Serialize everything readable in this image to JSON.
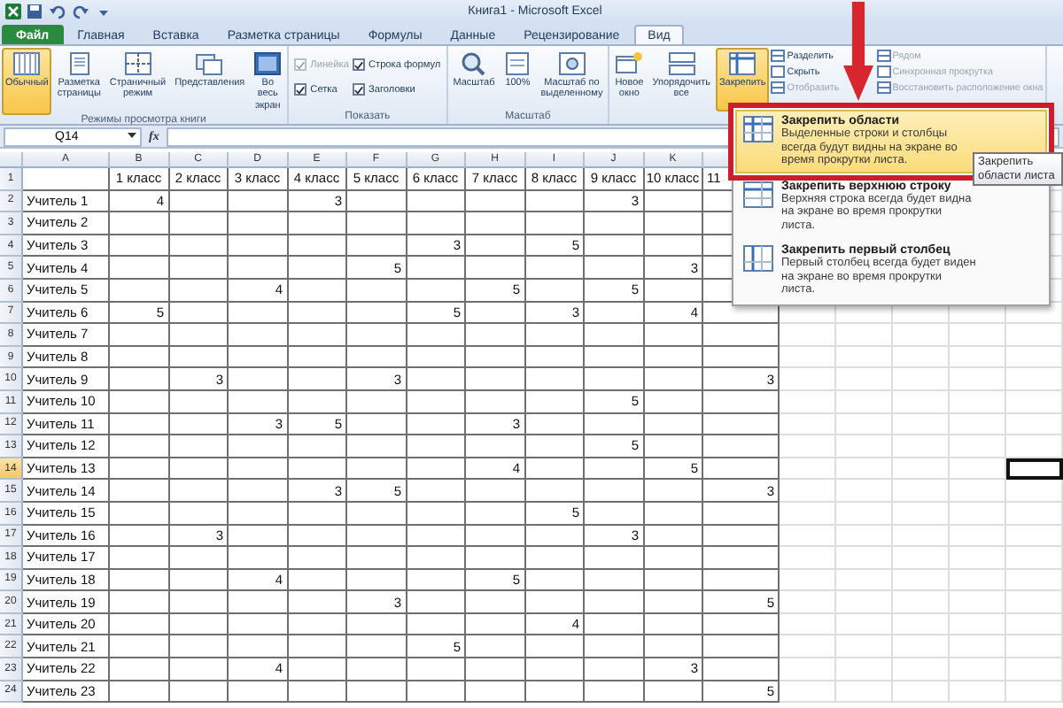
{
  "title_bar": {
    "title": "Книга1 - Microsoft Excel"
  },
  "ribbon_tabs": [
    {
      "label": "Файл",
      "kind": "file",
      "selected": false
    },
    {
      "label": "Главная",
      "kind": "tab",
      "selected": false
    },
    {
      "label": "Вставка",
      "kind": "tab",
      "selected": false
    },
    {
      "label": "Разметка страницы",
      "kind": "tab",
      "selected": false
    },
    {
      "label": "Формулы",
      "kind": "tab",
      "selected": false
    },
    {
      "label": "Данные",
      "kind": "tab",
      "selected": false
    },
    {
      "label": "Рецензирование",
      "kind": "tab",
      "selected": false
    },
    {
      "label": "Вид",
      "kind": "tab",
      "selected": true
    }
  ],
  "ribbon_groups": [
    {
      "label": "Режимы просмотра книги",
      "items": [
        {
          "kind": "large",
          "label": "Обычный",
          "selected": true
        },
        {
          "kind": "large",
          "label": "Разметка страницы",
          "selected": false
        },
        {
          "kind": "large",
          "label": "Страничный режим",
          "selected": false
        },
        {
          "kind": "large",
          "label": "Представления",
          "selected": false
        },
        {
          "kind": "large",
          "label": "Во весь экран",
          "selected": false
        }
      ]
    },
    {
      "label": "Показать",
      "items": [
        {
          "kind": "check",
          "label": "Линейка",
          "checked": true,
          "disabled": true
        },
        {
          "kind": "check",
          "label": "Сетка",
          "checked": true,
          "disabled": false
        },
        {
          "kind": "check",
          "label": "Строка формул",
          "checked": true,
          "disabled": false
        },
        {
          "kind": "check",
          "label": "Заголовки",
          "checked": true,
          "disabled": false
        }
      ]
    },
    {
      "label": "Масштаб",
      "items": [
        {
          "kind": "large",
          "label": "Масштаб",
          "selected": false
        },
        {
          "kind": "large",
          "label": "100%",
          "selected": false
        },
        {
          "kind": "large",
          "label": "Масштаб по выделенному",
          "selected": false
        }
      ]
    },
    {
      "items": [
        {
          "kind": "large",
          "label": "Новое окно",
          "selected": false
        },
        {
          "kind": "large",
          "label": "Упорядочить все",
          "selected": false
        },
        {
          "kind": "large",
          "label": "Закрепить",
          "selected": true
        },
        {
          "kind": "small",
          "label": "Разделить",
          "disabled": false
        },
        {
          "kind": "small",
          "label": "Скрыть",
          "disabled": false
        },
        {
          "kind": "small",
          "label": "Отобразить",
          "disabled": true
        },
        {
          "kind": "small",
          "label": "Рядом",
          "disabled": true
        },
        {
          "kind": "small",
          "label": "Синхронная прокрутка",
          "disabled": true
        },
        {
          "kind": "small",
          "label": "Восстановить расположение окна",
          "disabled": true
        }
      ]
    }
  ],
  "formula_bar": {
    "name_box": "Q14",
    "fx": "fx"
  },
  "sheet": {
    "column_letters": [
      "A",
      "B",
      "C",
      "D",
      "E",
      "F",
      "G",
      "H",
      "I",
      "J",
      "K"
    ],
    "header_row": {
      "number": "1",
      "labels": [
        "1 класс",
        "2 класс",
        "3 класс",
        "4 класс",
        "5 класс",
        "6 класс",
        "7 класс",
        "8 класс",
        "9 класс",
        "10 класс",
        "11"
      ]
    },
    "rows": [
      {
        "number": "2",
        "selected": false,
        "teacher": "Учитель 1",
        "cells": [
          "4",
          null,
          null,
          "3",
          null,
          null,
          null,
          null,
          "3",
          null,
          null
        ]
      },
      {
        "number": "3",
        "selected": false,
        "teacher": "Учитель 2",
        "cells": [
          null,
          null,
          null,
          null,
          null,
          null,
          null,
          null,
          null,
          null,
          null
        ]
      },
      {
        "number": "4",
        "selected": false,
        "teacher": "Учитель 3",
        "cells": [
          null,
          null,
          null,
          null,
          null,
          "3",
          null,
          "5",
          null,
          null,
          null
        ]
      },
      {
        "number": "5",
        "selected": false,
        "teacher": "Учитель 4",
        "cells": [
          null,
          null,
          null,
          null,
          "5",
          null,
          null,
          null,
          null,
          "3",
          null
        ]
      },
      {
        "number": "6",
        "selected": false,
        "teacher": "Учитель 5",
        "cells": [
          null,
          null,
          "4",
          null,
          null,
          null,
          "5",
          null,
          "5",
          null,
          null
        ]
      },
      {
        "number": "7",
        "selected": false,
        "teacher": "Учитель 6",
        "cells": [
          "5",
          null,
          null,
          null,
          null,
          "5",
          null,
          "3",
          null,
          "4",
          null
        ]
      },
      {
        "number": "8",
        "selected": false,
        "teacher": "Учитель 7",
        "cells": [
          null,
          null,
          null,
          null,
          null,
          null,
          null,
          null,
          null,
          null,
          null
        ]
      },
      {
        "number": "9",
        "selected": false,
        "teacher": "Учитель 8",
        "cells": [
          null,
          null,
          null,
          null,
          null,
          null,
          null,
          null,
          null,
          null,
          null
        ]
      },
      {
        "number": "10",
        "selected": false,
        "teacher": "Учитель 9",
        "cells": [
          null,
          "3",
          null,
          null,
          "3",
          null,
          null,
          null,
          null,
          null,
          "3"
        ]
      },
      {
        "number": "11",
        "selected": false,
        "teacher": "Учитель 10",
        "cells": [
          null,
          null,
          null,
          null,
          null,
          null,
          null,
          null,
          "5",
          null,
          null
        ]
      },
      {
        "number": "12",
        "selected": false,
        "teacher": "Учитель 11",
        "cells": [
          null,
          null,
          "3",
          "5",
          null,
          null,
          "3",
          null,
          null,
          null,
          null
        ]
      },
      {
        "number": "13",
        "selected": false,
        "teacher": "Учитель 12",
        "cells": [
          null,
          null,
          null,
          null,
          null,
          null,
          null,
          null,
          "5",
          null,
          null
        ]
      },
      {
        "number": "14",
        "selected": true,
        "teacher": "Учитель 13",
        "cells": [
          null,
          null,
          null,
          null,
          null,
          null,
          "4",
          null,
          null,
          "5",
          null
        ]
      },
      {
        "number": "15",
        "selected": false,
        "teacher": "Учитель 14",
        "cells": [
          null,
          null,
          null,
          "3",
          "5",
          null,
          null,
          null,
          null,
          null,
          "3"
        ]
      },
      {
        "number": "16",
        "selected": false,
        "teacher": "Учитель 15",
        "cells": [
          null,
          null,
          null,
          null,
          null,
          null,
          null,
          "5",
          null,
          null,
          null
        ]
      },
      {
        "number": "17",
        "selected": false,
        "teacher": "Учитель 16",
        "cells": [
          null,
          "3",
          null,
          null,
          null,
          null,
          null,
          null,
          "3",
          null,
          null
        ]
      },
      {
        "number": "18",
        "selected": false,
        "teacher": "Учитель 17",
        "cells": [
          null,
          null,
          null,
          null,
          null,
          null,
          null,
          null,
          null,
          null,
          null
        ]
      },
      {
        "number": "19",
        "selected": false,
        "teacher": "Учитель 18",
        "cells": [
          null,
          null,
          "4",
          null,
          null,
          null,
          "5",
          null,
          null,
          null,
          null
        ]
      },
      {
        "number": "20",
        "selected": false,
        "teacher": "Учитель 19",
        "cells": [
          null,
          null,
          null,
          null,
          "3",
          null,
          null,
          null,
          null,
          null,
          "5"
        ]
      },
      {
        "number": "21",
        "selected": false,
        "teacher": "Учитель 20",
        "cells": [
          null,
          null,
          null,
          null,
          null,
          null,
          null,
          "4",
          null,
          null,
          null
        ]
      },
      {
        "number": "22",
        "selected": false,
        "teacher": "Учитель 21",
        "cells": [
          null,
          null,
          null,
          null,
          null,
          "5",
          null,
          null,
          null,
          null,
          null
        ]
      },
      {
        "number": "23",
        "selected": false,
        "teacher": "Учитель 22",
        "cells": [
          null,
          null,
          "4",
          null,
          null,
          null,
          null,
          null,
          null,
          "3",
          null
        ]
      },
      {
        "number": "24",
        "selected": false,
        "teacher": "Учитель 23",
        "cells": [
          null,
          null,
          null,
          null,
          null,
          null,
          null,
          null,
          null,
          null,
          "5"
        ]
      }
    ]
  },
  "freeze_menu": {
    "tooltip": "Закрепить области листа",
    "items": [
      {
        "title": "Закрепить области",
        "description": "Выделенные строки и столбцы всегда будут видны на экране во время прокрутки листа.",
        "hovered": true
      },
      {
        "title": "Закрепить верхнюю строку",
        "description": "Верхняя строка всегда будет видна на экране во время прокрутки листа.",
        "hovered": false
      },
      {
        "title": "Закрепить первый столбец",
        "description": "Первый столбец всегда будет виден на экране во время прокрутки листа.",
        "hovered": false
      }
    ]
  }
}
